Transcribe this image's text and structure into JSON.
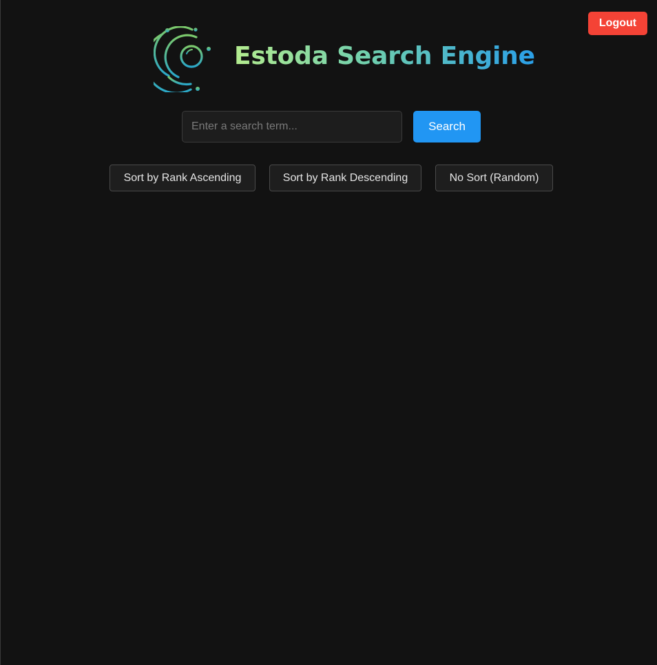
{
  "header": {
    "logout_label": "Logout",
    "brand_title": "Estoda Search Engine",
    "logo_icon": "search-logo-icon"
  },
  "search": {
    "placeholder": "Enter a search term...",
    "value": "",
    "button_label": "Search"
  },
  "sort": {
    "ascending_label": "Sort by Rank Ascending",
    "descending_label": "Sort by Rank Descending",
    "random_label": "No Sort (Random)"
  },
  "colors": {
    "background": "#121212",
    "logout": "#f44336",
    "search_button": "#2196f3",
    "title_gradient_start": "#b4ec8f",
    "title_gradient_end": "#2a9fe8"
  }
}
